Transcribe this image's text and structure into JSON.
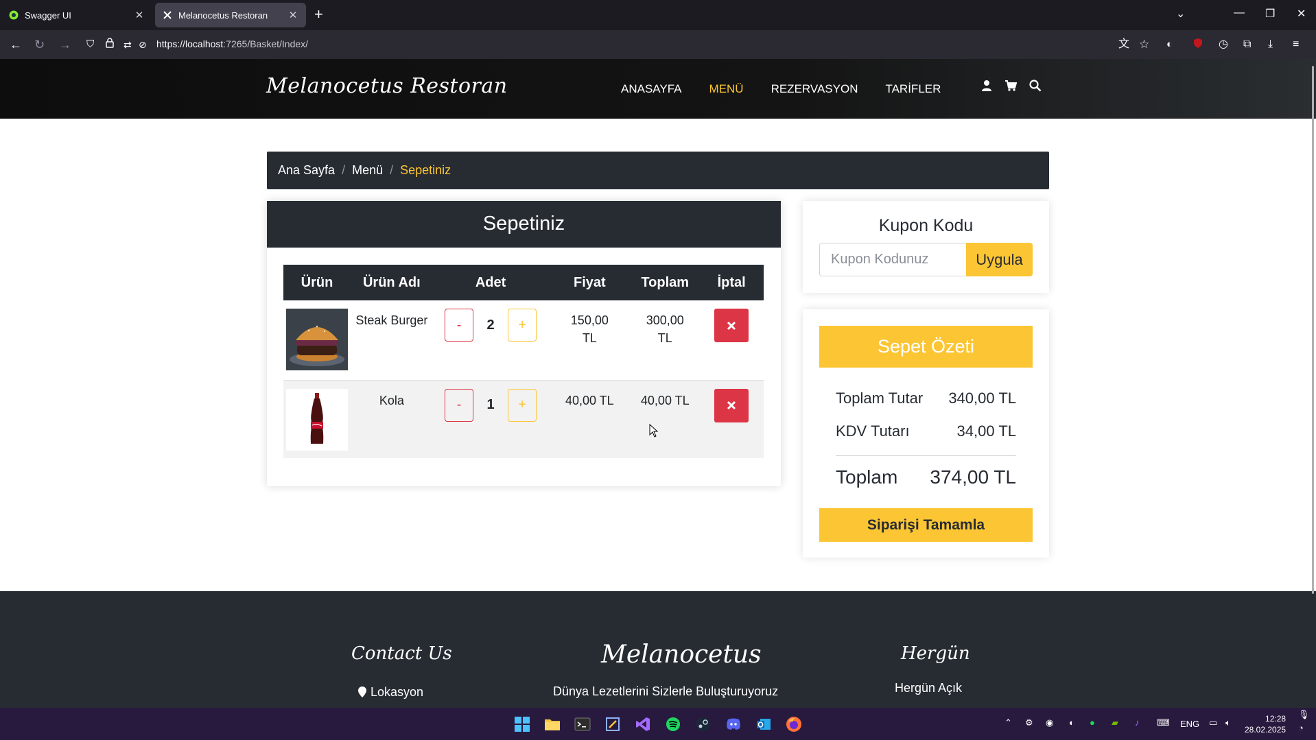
{
  "browser": {
    "tabs": [
      {
        "title": "Swagger UI",
        "active": false
      },
      {
        "title": "Melanocetus Restoran",
        "active": true
      }
    ],
    "url_host": "https://localhost",
    "url_rest": ":7265/Basket/Index/"
  },
  "site": {
    "logo": "Melanocetus Restoran",
    "nav": [
      "ANASAYFA",
      "MENÜ",
      "REZERVASYON",
      "TARİFLER"
    ],
    "active_nav": "MENÜ"
  },
  "breadcrumb": [
    "Ana Sayfa",
    "Menü",
    "Sepetiniz"
  ],
  "basket": {
    "title": "Sepetiniz",
    "columns": [
      "Ürün",
      "Ürün Adı",
      "Adet",
      "Fiyat",
      "Toplam",
      "İptal"
    ],
    "rows": [
      {
        "name": "Steak Burger",
        "qty": "2",
        "price": "150,00 TL",
        "total": "300,00 TL",
        "image": "burger"
      },
      {
        "name": "Kola",
        "qty": "1",
        "price": "40,00 TL",
        "total": "40,00 TL",
        "image": "cola"
      }
    ],
    "minus_label": "-",
    "plus_label": "+"
  },
  "coupon": {
    "title": "Kupon Kodu",
    "placeholder": "Kupon Kodunuz",
    "button": "Uygula"
  },
  "summary": {
    "title": "Sepet Özeti",
    "subtotal_label": "Toplam Tutar",
    "subtotal": "340,00 TL",
    "tax_label": "KDV Tutarı",
    "tax": "34,00 TL",
    "total_label": "Toplam",
    "total": "374,00 TL",
    "button": "Siparişi Tamamla"
  },
  "footer": {
    "contact_title": "Contact Us",
    "contact_item": "Lokasyon",
    "brand_title": "Melanocetus",
    "brand_text": "Dünya Lezetlerini Sizlerle Buluşturuyoruz",
    "hours_title": "Hergün",
    "hours_text": "Hergün Açık"
  },
  "taskbar": {
    "lang": "ENG",
    "time": "12:28",
    "date": "28.02.2025"
  },
  "colors": {
    "accent": "#fcc533",
    "dark": "#272c33",
    "danger": "#dc3545"
  }
}
